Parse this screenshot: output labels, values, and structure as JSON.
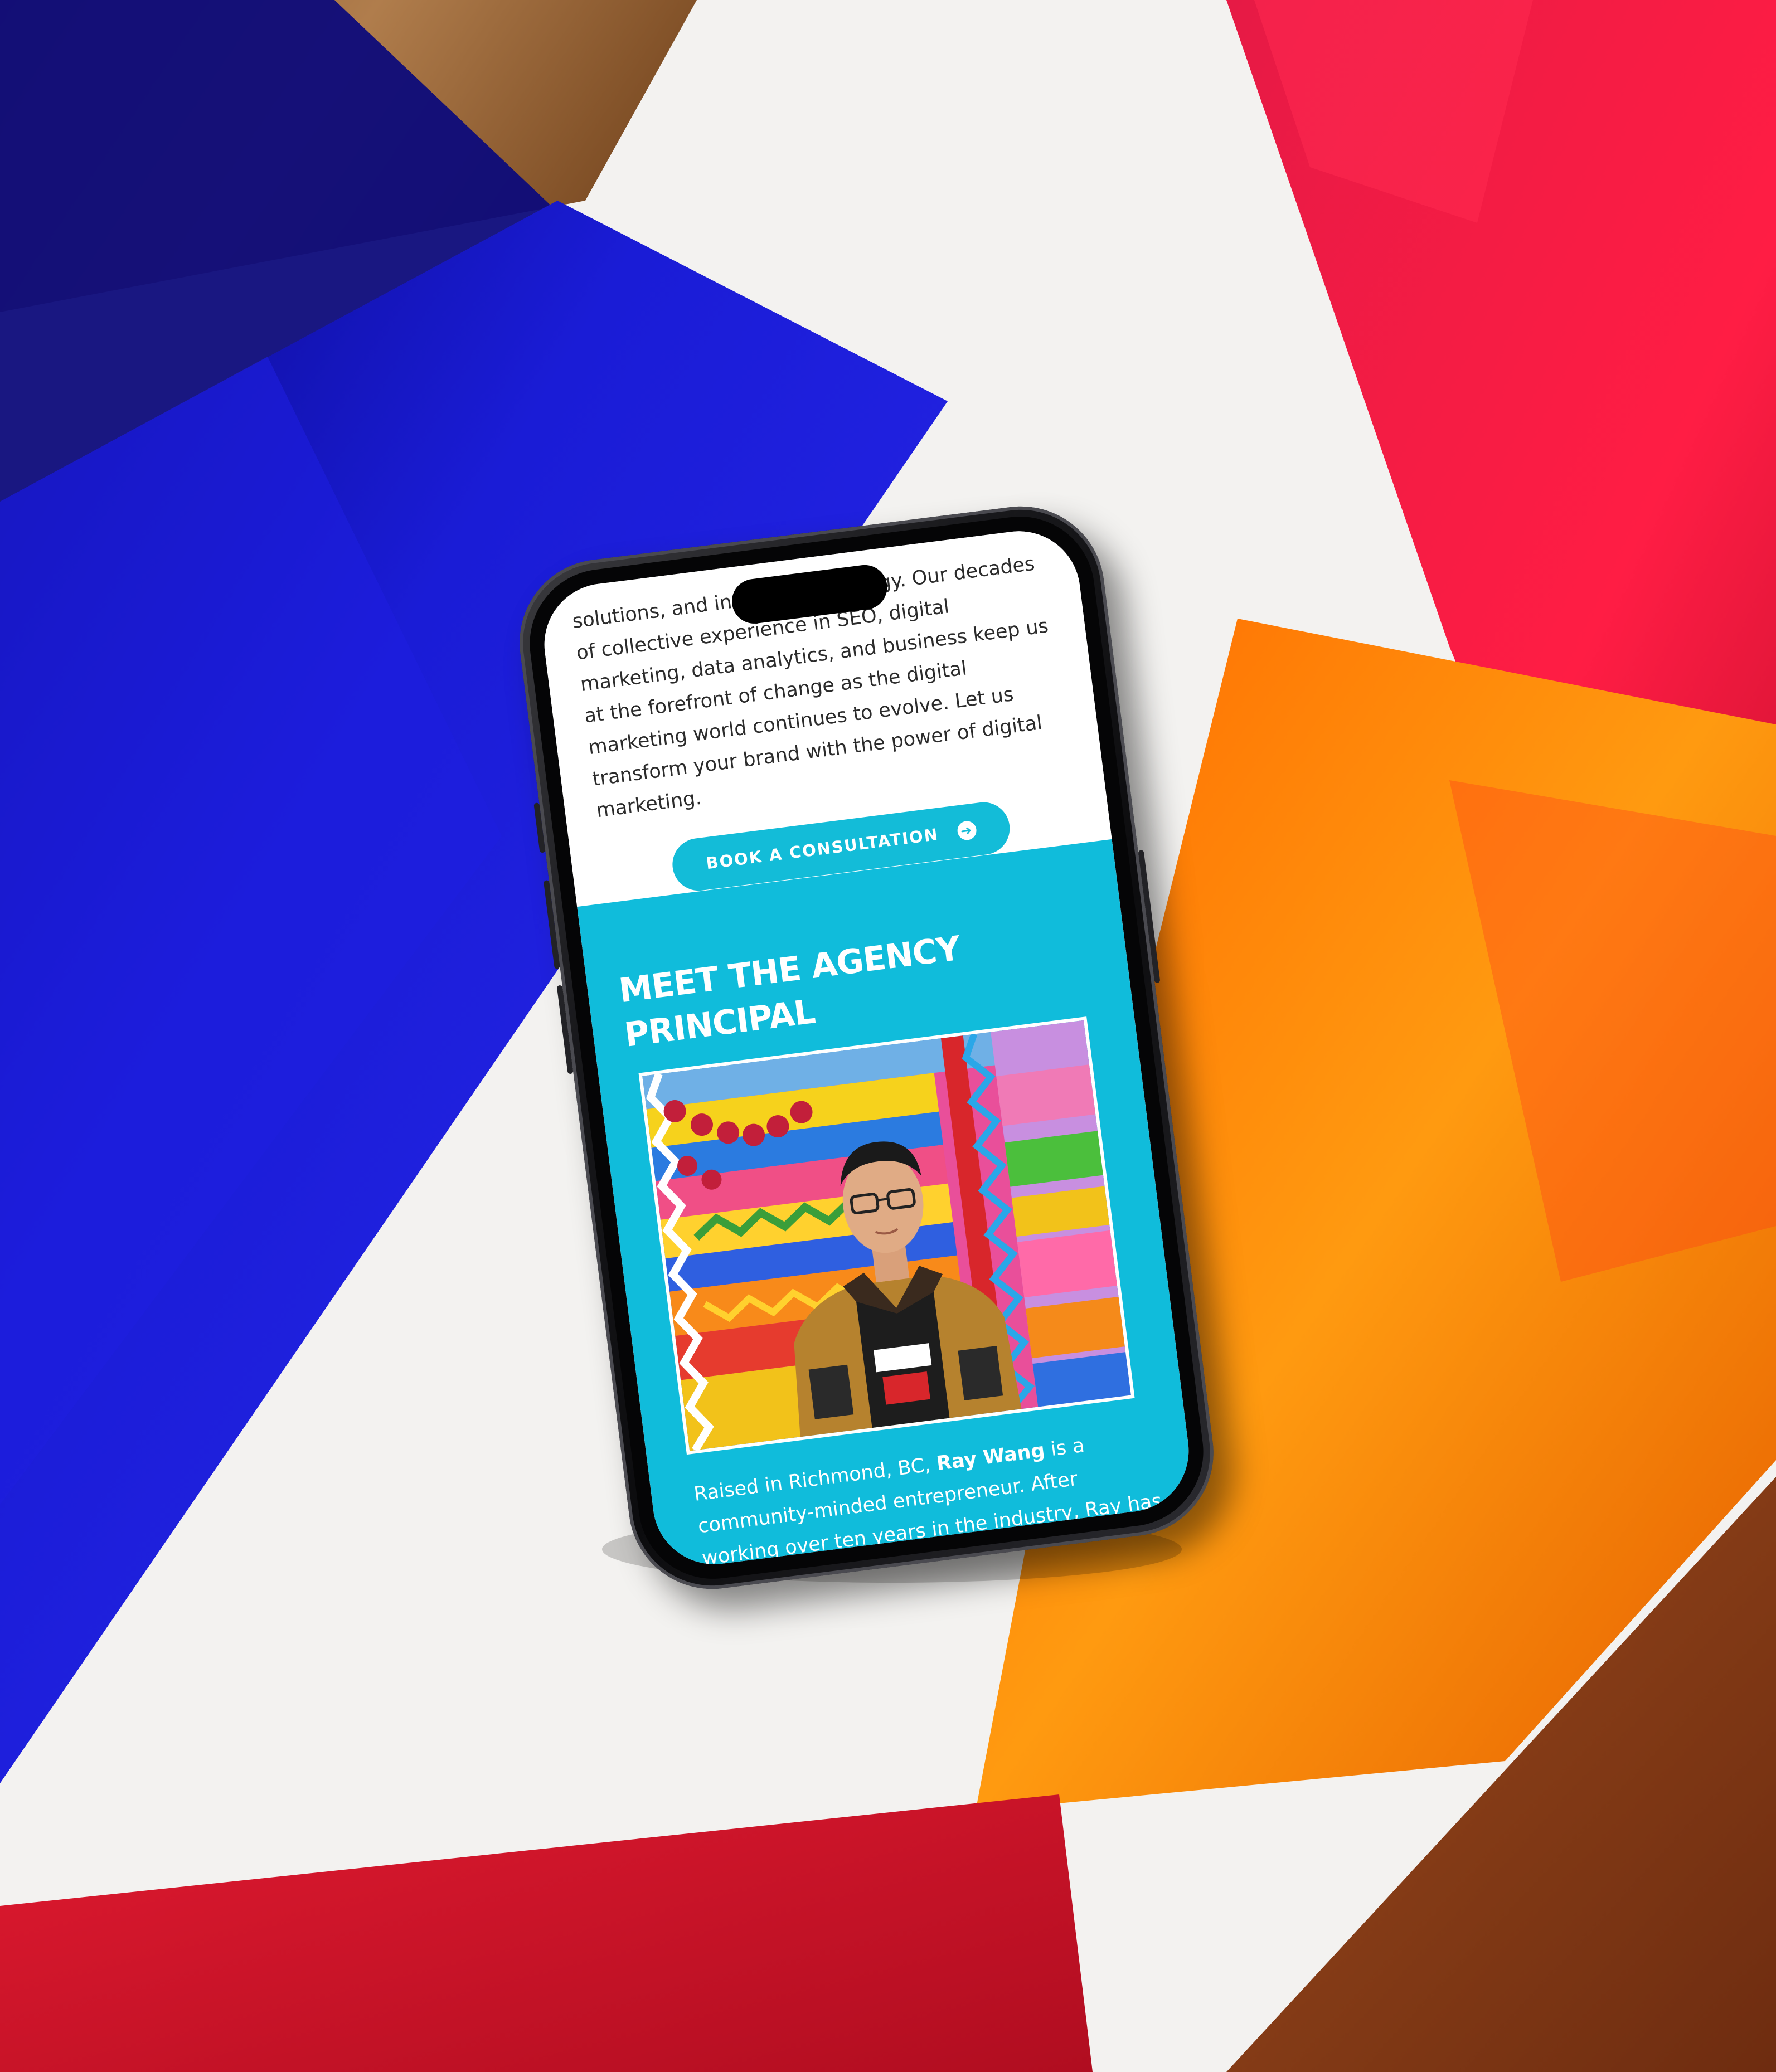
{
  "intro": {
    "paragraph": "solutions, and innovative strategy. Our decades of collective experience in SEO, digital marketing, data analytics, and business keep us at the forefront of change as the digital marketing world continues to evolve. Let us transform your brand with the power of digital marketing."
  },
  "cta": {
    "label": "BOOK A CONSULTATION",
    "icon": "arrow-circle-right-icon"
  },
  "principal": {
    "heading": "MEET THE AGENCY PRINCIPAL",
    "bio_prefix": "Raised in Richmond, BC, ",
    "bio_name": "Ray Wang",
    "bio_suffix": " is a community-minded entrepreneur. After working over ten years in the industry, Ray has seen first-hand the importance of"
  },
  "colors": {
    "accent": "#13bcd8",
    "section_bg": "#10bcdb",
    "text_dark": "#2b2b2b",
    "blue_panel": "#1c1cd8",
    "red_panel": "#f2173f",
    "orange_panel": "#ff8a00",
    "wood": "#a06a3a"
  }
}
